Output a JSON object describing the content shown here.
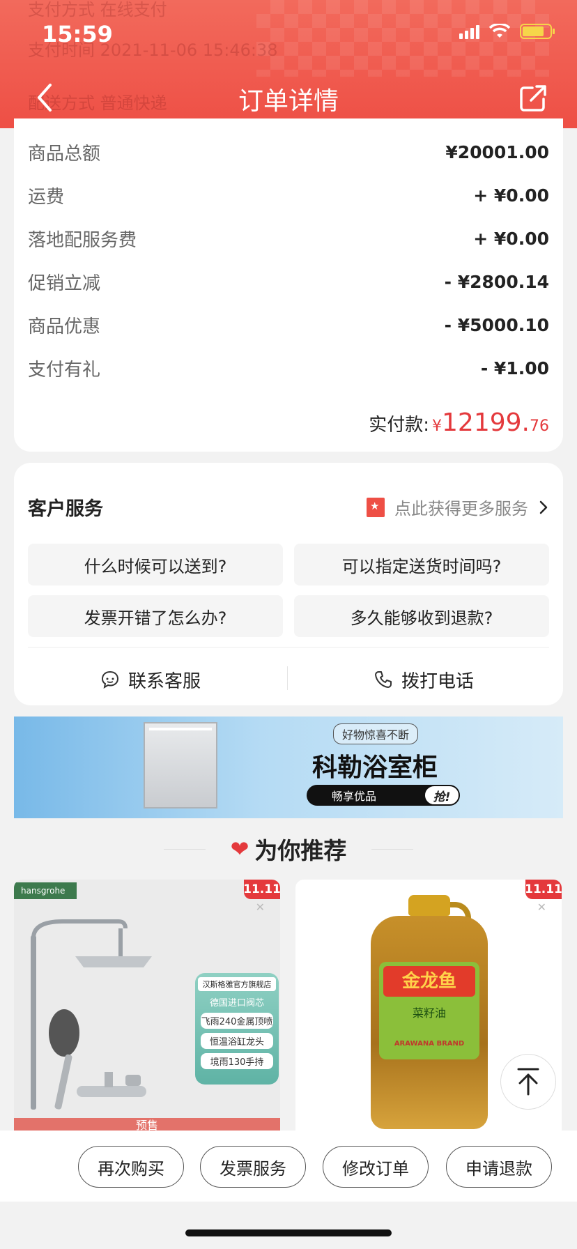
{
  "status_bar": {
    "time": "15:59"
  },
  "header": {
    "title": "订单详情",
    "ghost_rows": [
      "支付方式    在线支付",
      "支付时间    2021-11-06 15:46:38",
      "配送方式    普通快递"
    ]
  },
  "price": {
    "rows": [
      {
        "label": "商品总额",
        "value": "¥20001.00"
      },
      {
        "label": "运费",
        "value": "+ ¥0.00"
      },
      {
        "label": "落地配服务费",
        "value": "+ ¥0.00"
      },
      {
        "label": "促销立减",
        "value": "- ¥2800.14"
      },
      {
        "label": "商品优惠",
        "value": "- ¥5000.10"
      },
      {
        "label": "支付有礼",
        "value": "- ¥1.00"
      }
    ],
    "total_label": "实付款:",
    "total_currency": "¥",
    "total_integer": "12199.",
    "total_decimal": "76"
  },
  "service": {
    "title": "客户服务",
    "more_label": "点此获得更多服务",
    "faqs": [
      "什么时候可以送到?",
      "可以指定送货时间吗?",
      "发票开错了怎么办?",
      "多久能够收到退款?"
    ],
    "contact_label": "联系客服",
    "phone_label": "拨打电话"
  },
  "banner": {
    "badge": "好物惊喜不断",
    "title": "科勒浴室柜",
    "pill": "畅享优品",
    "grab": "抢!"
  },
  "recommend": {
    "title": "为你推荐",
    "tag": "11.11",
    "product1": {
      "brand": "hansgrohe",
      "store": "汉斯格雅官方旗舰店",
      "line": "德国进口阀芯",
      "chips": [
        "飞雨240金属顶喷",
        "恒温浴缸龙头",
        "境雨130手持"
      ],
      "presale": "预售"
    },
    "product2": {
      "brand": "金龙鱼",
      "sub": "菜籽油",
      "en": "ARAWANA BRAND"
    }
  },
  "bottom_bar": {
    "buttons": [
      "再次购买",
      "发票服务",
      "修改订单",
      "申请退款"
    ]
  },
  "colors": {
    "accent": "#e4393c",
    "header": "#ee4f45"
  }
}
